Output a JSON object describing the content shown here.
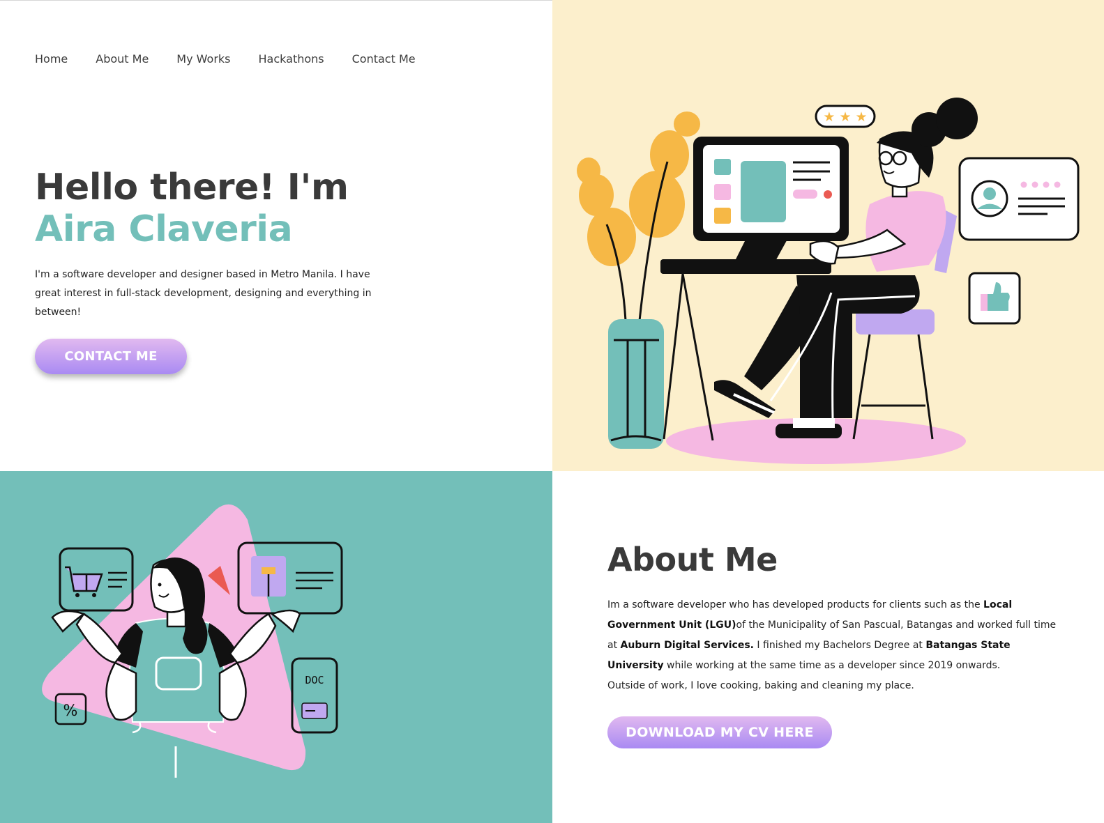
{
  "nav": {
    "items": [
      "Home",
      "About Me",
      "My Works",
      "Hackathons",
      "Contact Me"
    ]
  },
  "hero": {
    "greeting": "Hello there! I'm",
    "name": "Aira Claveria",
    "description": "I'm a software developer and designer based in Metro Manila. I have great interest in full-stack development, designing and everything in between!",
    "cta_label": "CONTACT ME"
  },
  "about": {
    "title": "About Me",
    "p1": "Im a software developer who has developed products for clients such as the ",
    "b1": "Local Government Unit (LGU)",
    "p2": "of the Municipality of San Pascual, Batangas and worked full time at ",
    "b2": "Auburn Digital Services.",
    "p3": " I finished my Bachelors Degree at ",
    "b3": "Batangas State University",
    "p4": " while working at the same time as a developer since 2019 onwards.",
    "p5": "Outside of work, I love cooking, baking and cleaning my place.",
    "cta_label": "DOWNLOAD MY CV HERE"
  },
  "illustrations": {
    "hero_card_symbol": "%",
    "doc_label": "DOC",
    "rating_stars": 3
  },
  "colors": {
    "teal": "#73bfb9",
    "cream": "#fcefcc",
    "pink": "#f5b8e2",
    "lavender": "#c0a8f0",
    "mustard": "#f6b846",
    "dark_text": "#3a3a3a"
  }
}
